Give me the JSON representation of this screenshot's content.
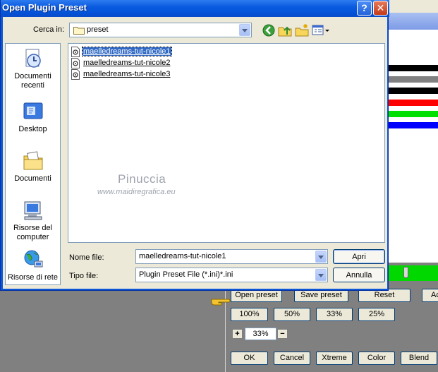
{
  "dialog": {
    "title": "Open Plugin Preset",
    "help_glyph": "?",
    "close_glyph": "✕",
    "look_in_label": "Cerca in:",
    "look_in_value": "preset",
    "places": [
      {
        "label": "Documenti recenti",
        "icon": "recent-documents-icon"
      },
      {
        "label": "Desktop",
        "icon": "desktop-icon"
      },
      {
        "label": "Documenti",
        "icon": "my-documents-icon"
      },
      {
        "label": "Risorse del computer",
        "icon": "my-computer-icon"
      },
      {
        "label": "Risorse di rete",
        "icon": "network-icon"
      }
    ],
    "files": [
      {
        "name": "maelledreams-tut-nicole1",
        "selected": true
      },
      {
        "name": "maelledreams-tut-nicole2",
        "selected": false
      },
      {
        "name": "maelledreams-tut-nicole3",
        "selected": false
      }
    ],
    "filename_label": "Nome file:",
    "filename_value": "maelledreams-tut-nicole1",
    "filetype_label": "Tipo file:",
    "filetype_value": "Plugin Preset File (*.ini)*.ini",
    "open_button": "Apri",
    "cancel_button": "Annulla"
  },
  "watermark": {
    "name": "Pinuccia",
    "url": "www.maidiregrafica.eu"
  },
  "plugin": {
    "preset_buttons": [
      "Open preset",
      "Save preset",
      "Reset",
      "Ac"
    ],
    "zoom_buttons": [
      "100%",
      "50%",
      "33%",
      "25%"
    ],
    "zoom_plus": "+",
    "zoom_minus": "−",
    "zoom_value": "33%",
    "action_buttons": [
      "OK",
      "Cancel",
      "Xtreme",
      "Color",
      "Blend"
    ],
    "stripe_colors": [
      "#000000",
      "#808080",
      "#000000",
      "#ff0000",
      "#00e000",
      "#0000ff"
    ],
    "accent_green": "#00d800",
    "title_blue": "#0a58d8"
  }
}
